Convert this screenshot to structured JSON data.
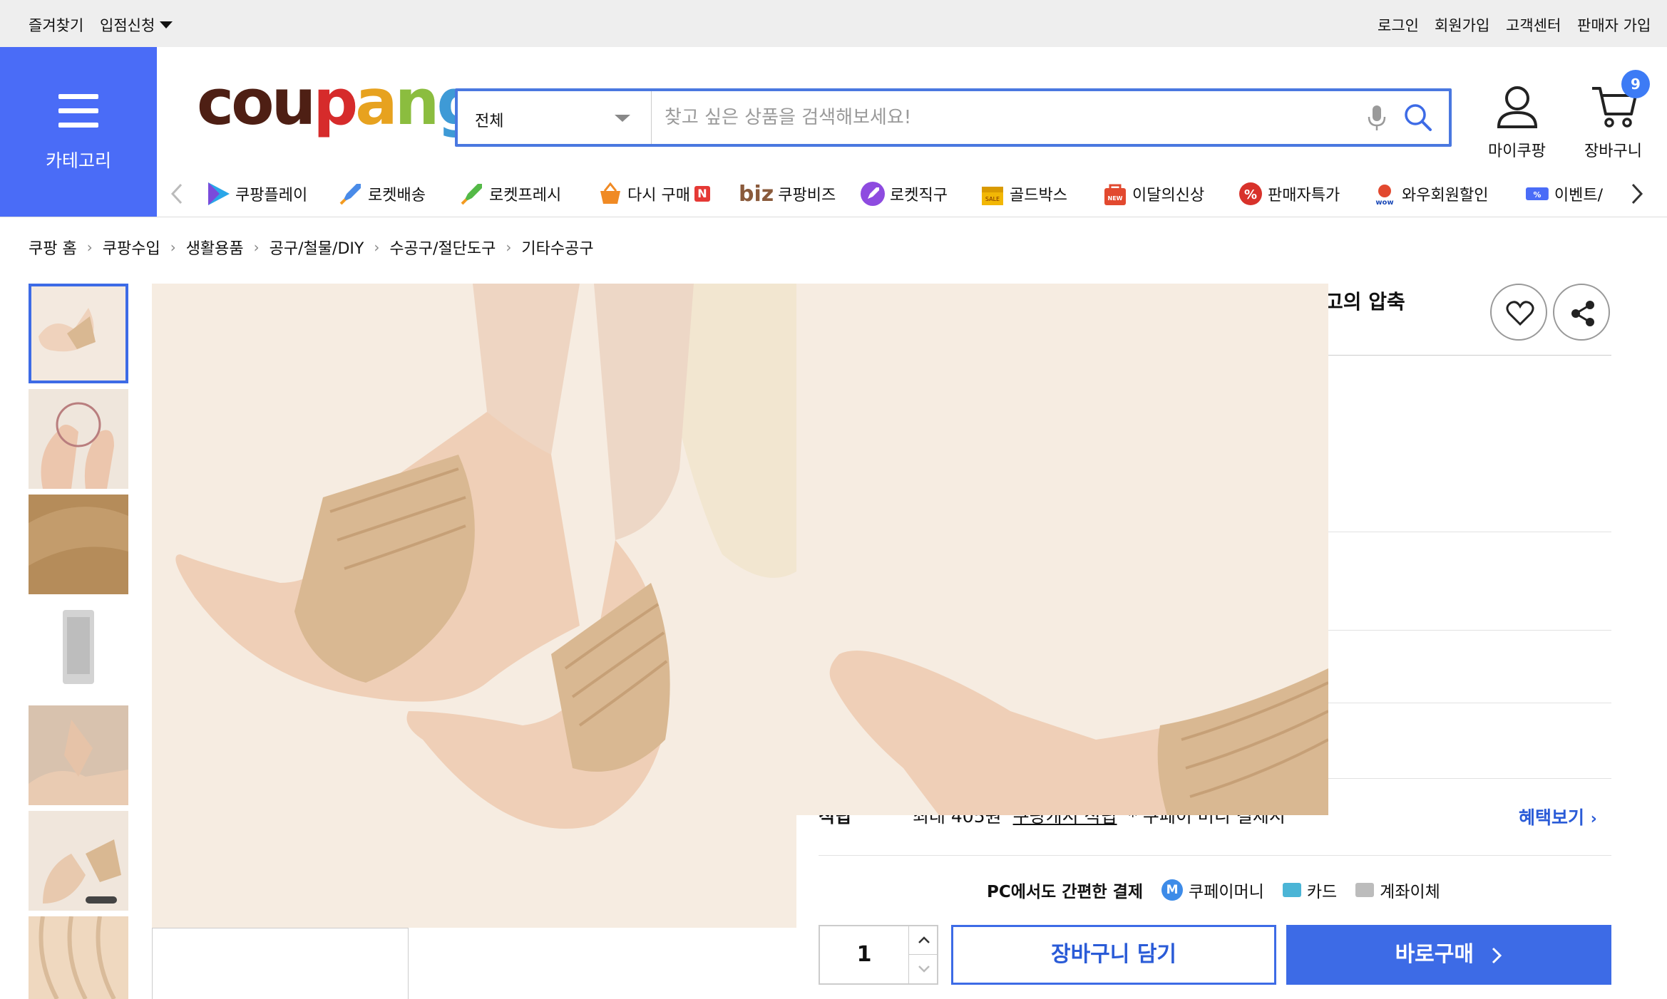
{
  "topbar": {
    "left": [
      "즐겨찾기",
      "입점신청"
    ],
    "right": [
      "로그인",
      "회원가입",
      "고객센터",
      "판매자 가입"
    ]
  },
  "category_button": {
    "label": "카테고리"
  },
  "logo": {
    "letters": [
      "c",
      "o",
      "u",
      "p",
      "a",
      "n",
      "g"
    ],
    "colors": [
      "#4e1f14",
      "#4e1f14",
      "#4e1f14",
      "#d62b2b",
      "#e7a21f",
      "#8bbd3f",
      "#3e9ad6"
    ]
  },
  "search": {
    "category": "전체",
    "placeholder": "찾고 싶은 상품을 검색해보세요!"
  },
  "header_icons": {
    "mycoupang": "마이쿠팡",
    "cart": "장바구니",
    "cart_count": "9"
  },
  "shortcuts": [
    {
      "label": "쿠팡플레이",
      "icon": "play-icon"
    },
    {
      "label": "로켓배송",
      "icon": "rocket-icon"
    },
    {
      "label": "로켓프레시",
      "icon": "rocket-fresh-icon"
    },
    {
      "label": "다시 구매",
      "icon": "basket-icon",
      "badge": "N"
    },
    {
      "label": "쿠팡비즈",
      "icon": "biz-logo",
      "prefix": "biz"
    },
    {
      "label": "로켓직구",
      "icon": "rocket-global-icon"
    },
    {
      "label": "골드박스",
      "icon": "goldbox-icon"
    },
    {
      "label": "이달의신상",
      "icon": "new-bag-icon"
    },
    {
      "label": "판매자특가",
      "icon": "percent-badge-icon"
    },
    {
      "label": "와우회원할인",
      "icon": "wow-icon"
    },
    {
      "label": "이벤트/",
      "icon": "event-icon"
    }
  ],
  "breadcrumb": [
    "쿠팡 홈",
    "쿠팡수입",
    "생활용품",
    "공구/철물/DIY",
    "수공구/절단도구",
    "기타수공구"
  ],
  "product": {
    "title_fragment": "고의 압축",
    "benefit_label": "적립",
    "benefit_amount": "최대 405원",
    "benefit_link_text": "쿠팡캐시 적립",
    "benefit_suffix": "* 쿠페이 머니 결제시",
    "benefit_view": "혜택보기"
  },
  "payment": {
    "title": "PC에서도 간편한 결제",
    "methods": [
      "쿠페이머니",
      "카드",
      "계좌이체"
    ]
  },
  "purchase": {
    "quantity": "1",
    "cart_button": "장바구니 담기",
    "buy_button": "바로구매"
  },
  "colors": {
    "accent": "#3d6be6",
    "category_bg": "#4a6cf7",
    "skin": "#f6ece1",
    "sock": "#d9b892"
  }
}
